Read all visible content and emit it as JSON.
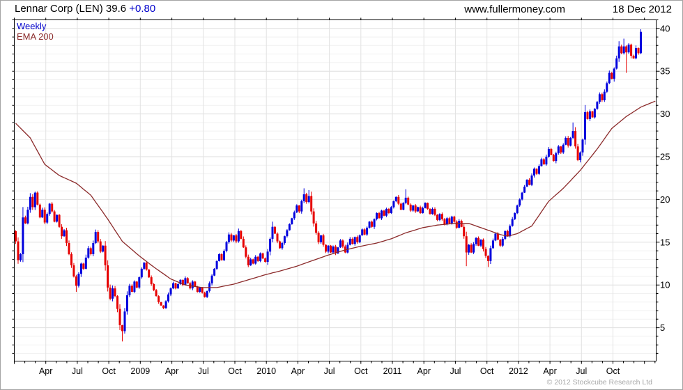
{
  "header": {
    "title_left": "Lennar Corp (LEN) 39.6",
    "title_change": "+0.80",
    "site": "www.fullermoney.com",
    "date": "18 Dec 2012"
  },
  "legend": {
    "series1": "Weekly",
    "series2": "EMA 200"
  },
  "footer": {
    "copyright": "© 2012 Stockcube Research Ltd"
  },
  "colors": {
    "candle_up": "#0000dd",
    "candle_down": "#e60000",
    "ema_line": "#8b2a2a",
    "legend_weekly": "#0000cc",
    "legend_ema": "#8b2a2a",
    "title_change": "#0000cc",
    "grid_minor": "#f1f1f1",
    "grid_major": "#dedede",
    "grid_vertical": "#e2e2e2",
    "axis": "#000000",
    "tick_label": "#000000",
    "copyright": "#a8a8a8"
  },
  "chart_data": {
    "type": "candlestick",
    "title": "Lennar Corp (LEN) weekly candlestick chart with 200-period EMA",
    "interval": "weekly",
    "x_start": "2008-01-07",
    "x_end": "2012-12-17",
    "last_close": 39.6,
    "last_change": 0.8,
    "ylim": [
      1.1,
      41.0
    ],
    "y_ticks_labeled": [
      5,
      10,
      15,
      20,
      25,
      30,
      35,
      40
    ],
    "y_minor_step": 1,
    "grid": true,
    "x_ticks": [
      {
        "label": "Apr",
        "month": 3
      },
      {
        "label": "Jul",
        "month": 6
      },
      {
        "label": "Oct",
        "month": 9
      },
      {
        "label": "2009",
        "month": 12
      },
      {
        "label": "Apr",
        "month": 15
      },
      {
        "label": "Jul",
        "month": 18
      },
      {
        "label": "Oct",
        "month": 21
      },
      {
        "label": "2010",
        "month": 24
      },
      {
        "label": "Apr",
        "month": 27
      },
      {
        "label": "Jul",
        "month": 30
      },
      {
        "label": "Oct",
        "month": 33
      },
      {
        "label": "2011",
        "month": 36
      },
      {
        "label": "Apr",
        "month": 39
      },
      {
        "label": "Jul",
        "month": 42
      },
      {
        "label": "Oct",
        "month": 45
      },
      {
        "label": "2012",
        "month": 48
      },
      {
        "label": "Apr",
        "month": 51
      },
      {
        "label": "Jul",
        "month": 54
      },
      {
        "label": "Oct",
        "month": 57
      }
    ],
    "months_total": 61,
    "first_open": 16.3,
    "closes": [
      15.1,
      12.9,
      13.6,
      17.9,
      17.2,
      18.8,
      20.3,
      19.1,
      20.8,
      19.4,
      17.9,
      18.8,
      17.3,
      18.3,
      19.5,
      18.6,
      17.4,
      18.2,
      16.8,
      15.7,
      16.4,
      14.9,
      13.6,
      12.3,
      11.0,
      9.9,
      11.3,
      12.5,
      11.9,
      13.2,
      14.3,
      13.6,
      14.9,
      16.2,
      15.1,
      13.9,
      14.6,
      12.3,
      9.7,
      8.4,
      9.6,
      8.7,
      7.2,
      5.3,
      4.6,
      6.9,
      8.8,
      9.9,
      9.2,
      10.4,
      9.7,
      10.9,
      11.9,
      12.6,
      11.8,
      10.9,
      10.1,
      9.4,
      8.7,
      8.0,
      7.6,
      7.3,
      8.1,
      8.9,
      9.6,
      10.2,
      9.6,
      10.1,
      10.6,
      10.0,
      10.8,
      10.2,
      9.6,
      10.4,
      9.8,
      9.2,
      9.7,
      9.1,
      8.6,
      9.3,
      10.2,
      11.1,
      11.9,
      12.8,
      13.6,
      12.9,
      14.0,
      15.0,
      15.9,
      15.2,
      15.8,
      15.1,
      16.3,
      15.4,
      14.4,
      13.3,
      12.3,
      13.0,
      12.5,
      13.3,
      12.8,
      13.7,
      13.1,
      12.7,
      13.9,
      15.4,
      16.8,
      16.0,
      15.1,
      14.3,
      14.9,
      15.7,
      16.4,
      17.1,
      17.8,
      18.5,
      19.3,
      18.6,
      19.8,
      20.6,
      19.7,
      20.4,
      18.6,
      17.2,
      16.1,
      15.0,
      15.8,
      14.7,
      13.9,
      14.6,
      13.8,
      14.5,
      13.7,
      14.4,
      15.2,
      14.5,
      13.8,
      14.7,
      15.4,
      14.8,
      15.6,
      15.0,
      15.8,
      16.5,
      15.9,
      16.7,
      17.4,
      16.8,
      17.7,
      18.4,
      17.8,
      18.7,
      18.1,
      18.9,
      18.4,
      19.1,
      19.8,
      20.3,
      19.5,
      18.8,
      19.6,
      20.2,
      19.4,
      18.7,
      19.3,
      18.6,
      19.1,
      18.4,
      19.0,
      19.6,
      18.9,
      18.3,
      18.9,
      18.2,
      17.6,
      18.3,
      17.7,
      17.1,
      17.8,
      17.2,
      18.0,
      17.4,
      16.7,
      17.5,
      16.8,
      15.7,
      13.8,
      14.7,
      13.8,
      14.8,
      15.5,
      14.6,
      15.3,
      14.2,
      13.4,
      12.8,
      14.3,
      15.2,
      16.0,
      15.3,
      14.6,
      15.4,
      16.3,
      15.7,
      16.9,
      17.7,
      18.4,
      19.3,
      20.0,
      20.8,
      21.5,
      22.3,
      21.7,
      22.8,
      23.6,
      23.0,
      23.9,
      24.7,
      24.1,
      25.0,
      25.9,
      25.2,
      24.5,
      25.4,
      26.2,
      25.5,
      26.4,
      27.2,
      26.3,
      27.2,
      28.0,
      26.2,
      24.6,
      25.5,
      27.0,
      30.2,
      29.4,
      30.3,
      29.6,
      30.6,
      31.4,
      32.3,
      31.6,
      32.6,
      33.6,
      34.8,
      34.1,
      35.3,
      36.5,
      37.9,
      37.1,
      37.9,
      37.2,
      38.1,
      36.8,
      36.5,
      37.7,
      37.1,
      39.6
    ],
    "wick_overrides": {
      "25": {
        "low": 9.2
      },
      "44": {
        "low": 3.4
      },
      "106": {
        "high": 17.4
      },
      "119": {
        "high": 21.3
      },
      "121": {
        "high": 21.1
      },
      "161": {
        "high": 21.2
      },
      "186": {
        "low": 12.2
      },
      "195": {
        "low": 12.1
      },
      "230": {
        "high": 29.0
      },
      "249": {
        "high": 38.5
      },
      "251": {
        "high": 38.8
      },
      "252": {
        "low": 34.8
      },
      "258": {
        "high": 39.9,
        "low": 37.0
      }
    },
    "ema": {
      "name": "EMA 200",
      "anchors": [
        [
          0,
          28.9
        ],
        [
          6,
          27.2
        ],
        [
          12,
          24.1
        ],
        [
          18,
          22.8
        ],
        [
          25,
          21.9
        ],
        [
          31,
          20.5
        ],
        [
          38,
          17.7
        ],
        [
          44,
          15.1
        ],
        [
          51,
          13.4
        ],
        [
          57,
          12.1
        ],
        [
          64,
          10.7
        ],
        [
          70,
          10.0
        ],
        [
          77,
          9.7
        ],
        [
          83,
          9.7
        ],
        [
          90,
          10.1
        ],
        [
          96,
          10.6
        ],
        [
          103,
          11.2
        ],
        [
          110,
          11.7
        ],
        [
          116,
          12.2
        ],
        [
          123,
          12.9
        ],
        [
          129,
          13.5
        ],
        [
          136,
          14.1
        ],
        [
          142,
          14.5
        ],
        [
          149,
          14.9
        ],
        [
          155,
          15.4
        ],
        [
          161,
          16.1
        ],
        [
          168,
          16.7
        ],
        [
          174,
          17.0
        ],
        [
          181,
          17.2
        ],
        [
          187,
          17.2
        ],
        [
          194,
          16.5
        ],
        [
          200,
          15.9
        ],
        [
          203,
          15.7
        ],
        [
          207,
          16.0
        ],
        [
          213,
          16.9
        ],
        [
          220,
          19.8
        ],
        [
          226,
          21.3
        ],
        [
          233,
          23.4
        ],
        [
          240,
          25.9
        ],
        [
          246,
          28.3
        ],
        [
          252,
          29.7
        ],
        [
          258,
          30.8
        ],
        [
          264,
          31.5
        ]
      ]
    }
  }
}
